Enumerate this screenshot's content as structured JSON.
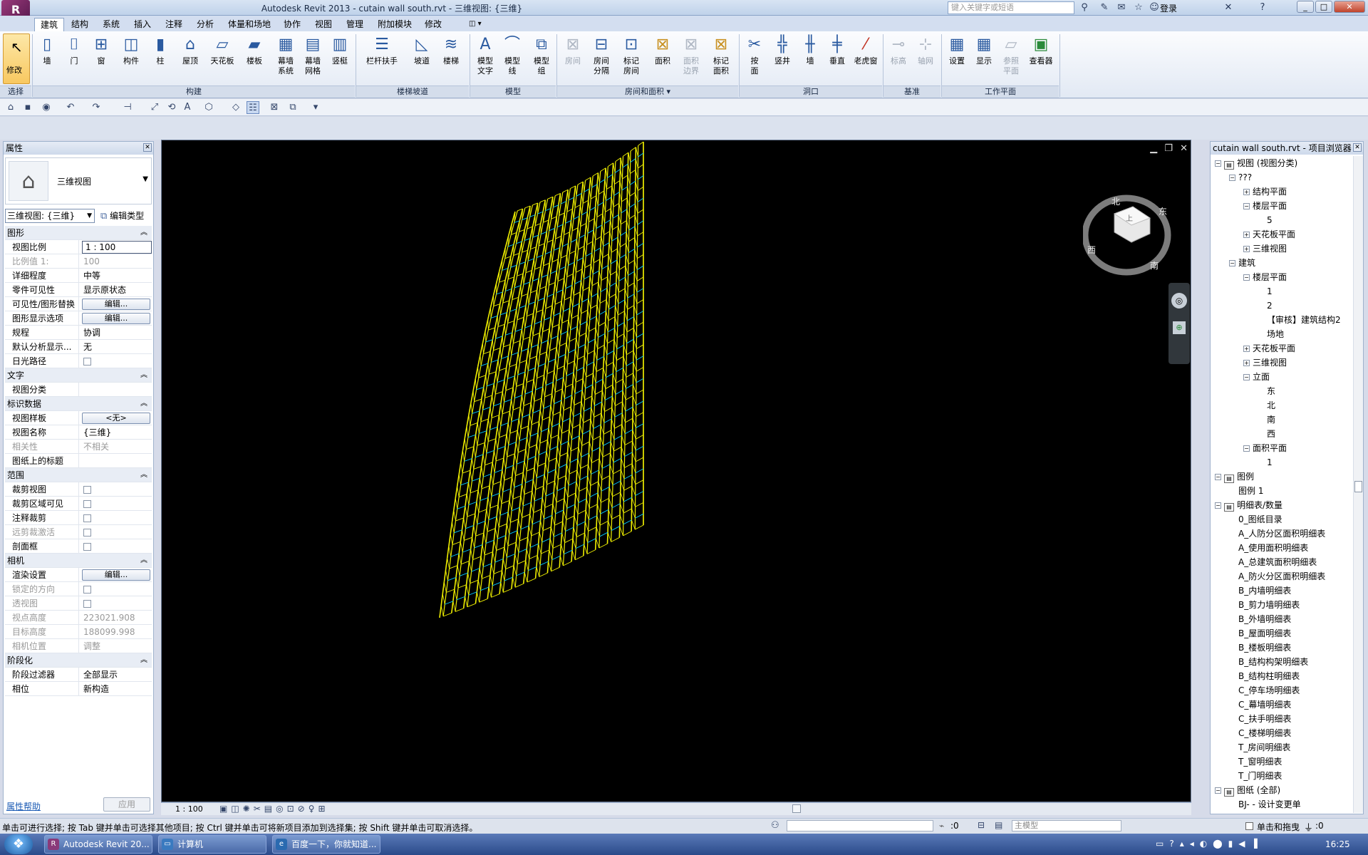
{
  "window": {
    "title": "Autodesk Revit 2013  -    cutain wall south.rvt - 三维视图: {三维}",
    "search_placeholder": "键入关键字或短语",
    "login": "登录"
  },
  "tabs": [
    "建筑",
    "结构",
    "系统",
    "插入",
    "注释",
    "分析",
    "体量和场地",
    "协作",
    "视图",
    "管理",
    "附加模块",
    "修改"
  ],
  "ribbon": {
    "modify": "修改",
    "select_panel": "选择",
    "build_buttons": [
      "墙",
      "门",
      "窗",
      "构件",
      "柱",
      "屋顶",
      "天花板",
      "楼板",
      "幕墙\n系统",
      "幕墙\n网格",
      "竖梃"
    ],
    "build_panel": "构建",
    "circ_buttons": [
      "栏杆扶手",
      "坡道",
      "楼梯"
    ],
    "circ_panel": "楼梯坡道",
    "model_buttons": [
      "模型\n文字",
      "模型\n线",
      "模型\n组"
    ],
    "model_panel": "模型",
    "room_buttons": [
      "房间",
      "房间\n分隔",
      "标记\n房间",
      "面积",
      "面积\n边界",
      "标记\n面积"
    ],
    "room_panel": "房间和面积 ▾",
    "opening_buttons": [
      "按\n面",
      "竖井",
      "墙",
      "垂直",
      "老虎窗"
    ],
    "opening_panel": "洞口",
    "datum_buttons": [
      "标高",
      "轴网"
    ],
    "datum_panel": "基准",
    "wp_buttons": [
      "设置",
      "显示",
      "参照\n平面",
      "查看器"
    ],
    "wp_panel": "工作平面"
  },
  "properties": {
    "header": "属性",
    "type_name": "三维视图",
    "view_selector": "三维视图: {三维}",
    "edit_type": "编辑类型",
    "rows": [
      {
        "kind": "cat",
        "k": "图形"
      },
      {
        "kind": "input",
        "k": "视图比例",
        "v": "1 : 100"
      },
      {
        "kind": "dim",
        "k": "比例值 1:",
        "v": "100"
      },
      {
        "kind": "text",
        "k": "详细程度",
        "v": "中等"
      },
      {
        "kind": "text",
        "k": "零件可见性",
        "v": "显示原状态"
      },
      {
        "kind": "btn",
        "k": "可见性/图形替换",
        "v": "编辑..."
      },
      {
        "kind": "btn",
        "k": "图形显示选项",
        "v": "编辑..."
      },
      {
        "kind": "text",
        "k": "规程",
        "v": "协调"
      },
      {
        "kind": "text",
        "k": "默认分析显示...",
        "v": "无"
      },
      {
        "kind": "chk",
        "k": "日光路径"
      },
      {
        "kind": "cat",
        "k": "文字"
      },
      {
        "kind": "text",
        "k": "视图分类",
        "v": ""
      },
      {
        "kind": "cat",
        "k": "标识数据"
      },
      {
        "kind": "btn",
        "k": "视图样板",
        "v": "<无>"
      },
      {
        "kind": "text",
        "k": "视图名称",
        "v": "{三维}"
      },
      {
        "kind": "dim",
        "k": "相关性",
        "v": "不相关"
      },
      {
        "kind": "text",
        "k": "图纸上的标题",
        "v": ""
      },
      {
        "kind": "cat",
        "k": "范围"
      },
      {
        "kind": "chk",
        "k": "裁剪视图"
      },
      {
        "kind": "chk",
        "k": "裁剪区域可见"
      },
      {
        "kind": "chk",
        "k": "注释裁剪"
      },
      {
        "kind": "chkdim",
        "k": "远剪裁激活"
      },
      {
        "kind": "chk",
        "k": "剖面框"
      },
      {
        "kind": "cat",
        "k": "相机"
      },
      {
        "kind": "btn",
        "k": "渲染设置",
        "v": "编辑..."
      },
      {
        "kind": "chkdim",
        "k": "锁定的方向"
      },
      {
        "kind": "chkdim",
        "k": "透视图"
      },
      {
        "kind": "dim",
        "k": "视点高度",
        "v": "223021.908"
      },
      {
        "kind": "dim",
        "k": "目标高度",
        "v": "188099.998"
      },
      {
        "kind": "dim",
        "k": "相机位置",
        "v": "调整"
      },
      {
        "kind": "cat",
        "k": "阶段化"
      },
      {
        "kind": "text",
        "k": "阶段过滤器",
        "v": "全部显示"
      },
      {
        "kind": "text",
        "k": "相位",
        "v": "新构造"
      }
    ],
    "help": "属性帮助",
    "apply": "应用"
  },
  "viewcube": {
    "top": "上",
    "north": "北",
    "east": "东",
    "south": "南",
    "west": "西"
  },
  "viewbar": {
    "scale": "1 : 100"
  },
  "browser": {
    "header": "cutain wall south.rvt - 项目浏览器",
    "nodes": [
      {
        "t": "视图 (视图分类)",
        "l": 0,
        "tog": "−",
        "ico": true
      },
      {
        "t": "???",
        "l": 1,
        "tog": "−"
      },
      {
        "t": "结构平面",
        "l": 2,
        "tog": "+"
      },
      {
        "t": "楼层平面",
        "l": 2,
        "tog": "−"
      },
      {
        "t": "5",
        "l": 3
      },
      {
        "t": "天花板平面",
        "l": 2,
        "tog": "+"
      },
      {
        "t": "三维视图",
        "l": 2,
        "tog": "+"
      },
      {
        "t": "建筑",
        "l": 1,
        "tog": "−"
      },
      {
        "t": "楼层平面",
        "l": 2,
        "tog": "−"
      },
      {
        "t": "1",
        "l": 3
      },
      {
        "t": "2",
        "l": 3
      },
      {
        "t": "【审核】建筑结构2",
        "l": 3
      },
      {
        "t": "场地",
        "l": 3
      },
      {
        "t": "天花板平面",
        "l": 2,
        "tog": "+"
      },
      {
        "t": "三维视图",
        "l": 2,
        "tog": "+"
      },
      {
        "t": "立面",
        "l": 2,
        "tog": "−"
      },
      {
        "t": "东",
        "l": 3
      },
      {
        "t": "北",
        "l": 3
      },
      {
        "t": "南",
        "l": 3
      },
      {
        "t": "西",
        "l": 3
      },
      {
        "t": "面积平面",
        "l": 2,
        "tog": "−"
      },
      {
        "t": "1",
        "l": 3
      },
      {
        "t": "图例",
        "l": 0,
        "tog": "−",
        "ico": true
      },
      {
        "t": "图例 1",
        "l": 1
      },
      {
        "t": "明细表/数量",
        "l": 0,
        "tog": "−",
        "ico": true
      },
      {
        "t": "0_图纸目录",
        "l": 1
      },
      {
        "t": "A_人防分区面积明细表",
        "l": 1
      },
      {
        "t": "A_使用面积明细表",
        "l": 1
      },
      {
        "t": "A_总建筑面积明细表",
        "l": 1
      },
      {
        "t": "A_防火分区面积明细表",
        "l": 1
      },
      {
        "t": "B_内墙明细表",
        "l": 1
      },
      {
        "t": "B_剪力墙明细表",
        "l": 1
      },
      {
        "t": "B_外墙明细表",
        "l": 1
      },
      {
        "t": "B_屋面明细表",
        "l": 1
      },
      {
        "t": "B_楼板明细表",
        "l": 1
      },
      {
        "t": "B_结构构架明细表",
        "l": 1
      },
      {
        "t": "B_结构柱明细表",
        "l": 1
      },
      {
        "t": "C_停车场明细表",
        "l": 1
      },
      {
        "t": "C_幕墙明细表",
        "l": 1
      },
      {
        "t": "C_扶手明细表",
        "l": 1
      },
      {
        "t": "C_楼梯明细表",
        "l": 1
      },
      {
        "t": "T_房间明细表",
        "l": 1
      },
      {
        "t": "T_窗明细表",
        "l": 1
      },
      {
        "t": "T_门明细表",
        "l": 1
      },
      {
        "t": "图纸 (全部)",
        "l": 0,
        "tog": "−",
        "ico": true
      },
      {
        "t": "BJ- - 设计变更单",
        "l": 1
      }
    ]
  },
  "status": {
    "text": "单击可进行选择; 按 Tab 键并单击可选择其他项目; 按 Ctrl 键并单击可将新项目添加到选择集; 按 Shift 键并单击可取消选择。",
    "worksets": ":0",
    "model": "主模型",
    "drag": "单击和拖曳",
    "filter": ":0"
  },
  "taskbar": {
    "items": [
      "Autodesk Revit 20...",
      "计算机",
      "百度一下，你就知道..."
    ],
    "clock": "16:25"
  },
  "colors": {
    "grid": "#f0f000",
    "grid_accent": "#00c8ff",
    "viewport": "#000000"
  }
}
